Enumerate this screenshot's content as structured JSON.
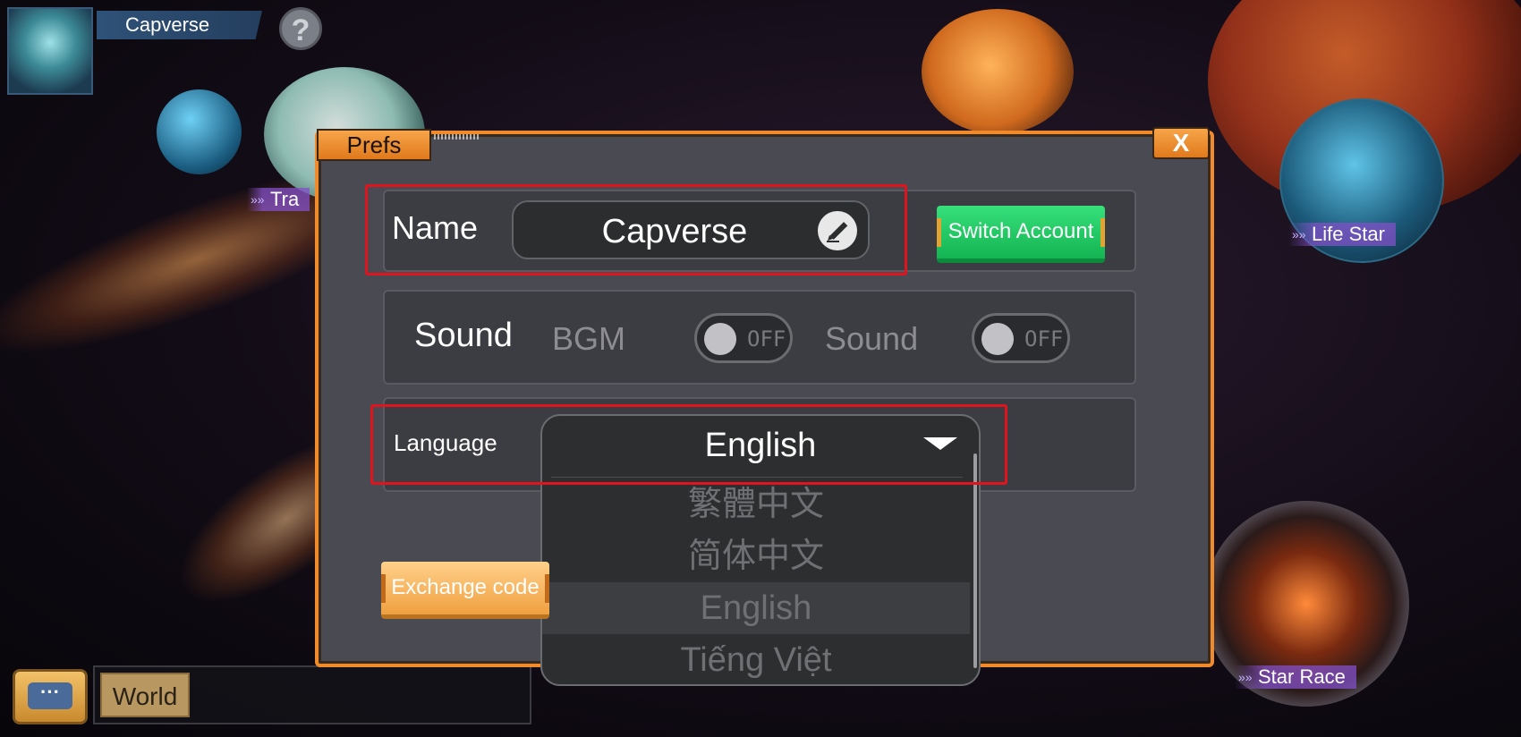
{
  "profile": {
    "name": "Capverse",
    "help_icon": "?"
  },
  "map_labels": {
    "left": "Tra",
    "life_star": "Life Star",
    "star_race": "Star Race",
    "chevrons": "»»"
  },
  "chat": {
    "world_tab": "World",
    "chat_icon": "···"
  },
  "dialog": {
    "title": "Prefs",
    "close_label": "X",
    "name_row": {
      "label": "Name",
      "value": "Capverse",
      "switch_account_label": "Switch Account"
    },
    "sound_row": {
      "label": "Sound",
      "bgm_label": "BGM",
      "bgm_state": "OFF",
      "sound_label": "Sound",
      "sound_state": "OFF"
    },
    "language_row": {
      "label": "Language",
      "selected": "English",
      "options": [
        "繁體中文",
        "简体中文",
        "English",
        "Tiếng Việt"
      ]
    },
    "exchange_code_label": "Exchange code"
  },
  "colors": {
    "accent_orange": "#f08a2a",
    "green_button": "#14b453",
    "highlight_box": "#e0141c"
  }
}
